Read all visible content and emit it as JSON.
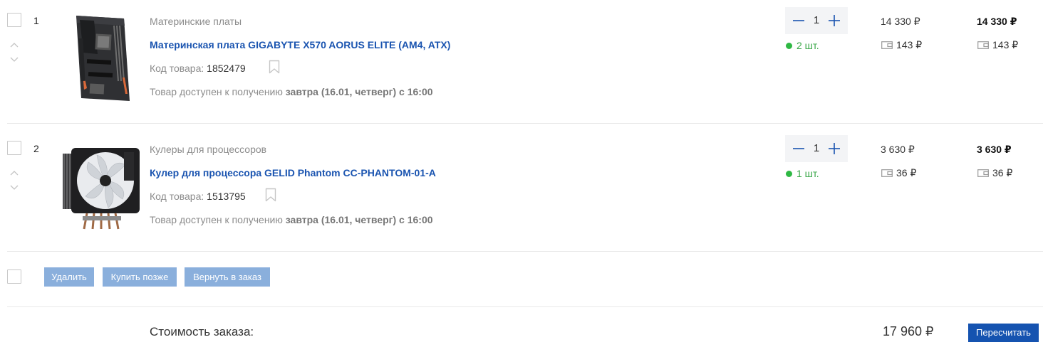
{
  "items": [
    {
      "index": "1",
      "category": "Материнские платы",
      "title": "Материнская плата GIGABYTE X570 AORUS ELITE (AM4, ATX)",
      "code_label": "Код товара:",
      "code": "1852479",
      "availability_prefix": "Товар доступен к получению",
      "availability_date": "завтра (16.01, четверг) с 16:00",
      "quantity": "1",
      "stock": "2 шт.",
      "unit_price": "14 330 ₽",
      "total_price": "14 330 ₽",
      "unit_bonus": "143 ₽",
      "total_bonus": "143 ₽",
      "image_icon": "motherboard-image"
    },
    {
      "index": "2",
      "category": "Кулеры для процессоров",
      "title": "Кулер для процессора GELID Phantom CC-PHANTOM-01-A",
      "code_label": "Код товара:",
      "code": "1513795",
      "availability_prefix": "Товар доступен к получению",
      "availability_date": "завтра (16.01, четверг) с 16:00",
      "quantity": "1",
      "stock": "1 шт.",
      "unit_price": "3 630 ₽",
      "total_price": "3 630 ₽",
      "unit_bonus": "36 ₽",
      "total_bonus": "36 ₽",
      "image_icon": "cpu-cooler-image"
    }
  ],
  "actions": {
    "delete_label": "Удалить",
    "buy_later_label": "Купить позже",
    "return_label": "Вернуть в заказ"
  },
  "summary": {
    "label": "Стоимость заказа:",
    "value": "17 960 ₽",
    "recalculate_label": "Пересчитать"
  },
  "colors": {
    "link": "#1a54b0",
    "accent": "#1553b0",
    "action_button": "#8aafdc",
    "stock_green": "#2eb843",
    "qty_bg": "#f3f4f6"
  }
}
